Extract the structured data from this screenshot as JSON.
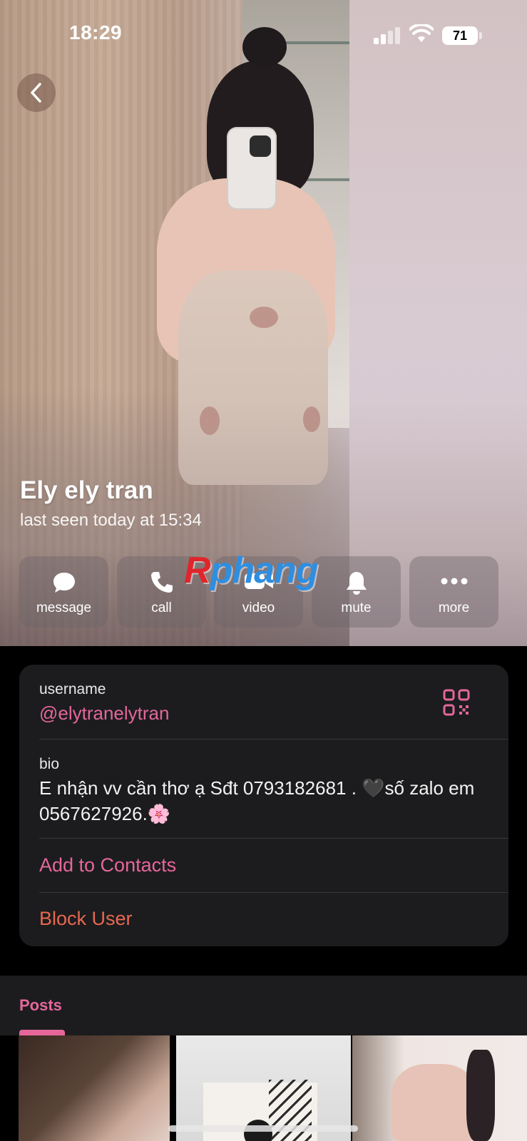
{
  "status_bar": {
    "time": "18:29",
    "battery": "71"
  },
  "profile": {
    "name": "Ely ely tran",
    "last_seen": "last seen today at 15:34"
  },
  "watermark": {
    "r": "R",
    "rest": "phang"
  },
  "actions": [
    {
      "label": "message",
      "icon": "chat-bubble-icon"
    },
    {
      "label": "call",
      "icon": "phone-icon"
    },
    {
      "label": "video",
      "icon": "video-camera-icon"
    },
    {
      "label": "mute",
      "icon": "bell-icon"
    },
    {
      "label": "more",
      "icon": "ellipsis-icon"
    }
  ],
  "info": {
    "username_label": "username",
    "username_value": "@elytranelytran",
    "bio_label": "bio",
    "bio_text": "E nhận vv cần thơ ạ Sđt 0793182681 . 🖤số zalo em 0567627926.🌸",
    "add_to_contacts": "Add to Contacts",
    "block_user": "Block User"
  },
  "tabs": {
    "posts": "Posts"
  },
  "colors": {
    "accent_pink": "#e5679a",
    "danger_orange": "#e8684f",
    "card_bg": "#1c1c1e"
  }
}
